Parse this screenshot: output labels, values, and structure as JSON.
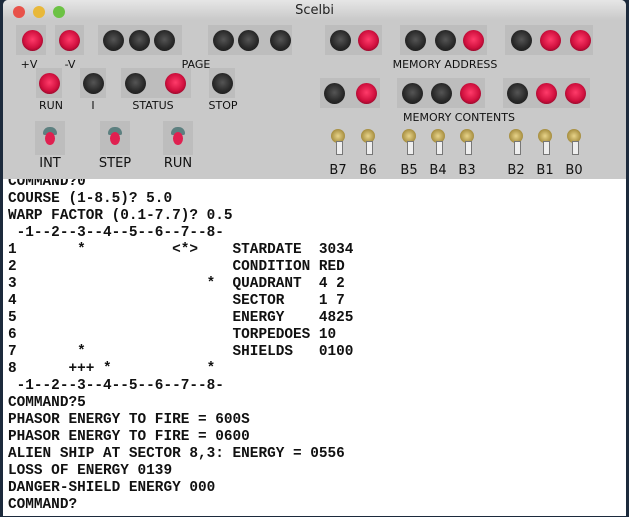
{
  "window": {
    "title": "Scelbi"
  },
  "panel": {
    "power_labels": [
      "+V",
      "-V"
    ],
    "page_label": "PAGE",
    "memory_address_label": "MEMORY ADDRESS",
    "memory_contents_label": "MEMORY CONTENTS",
    "status_labels": [
      "RUN",
      "I",
      "STATUS",
      "STOP"
    ],
    "switch_labels": [
      "INT",
      "STEP",
      "RUN"
    ],
    "bit_labels": [
      "B7",
      "B6",
      "B5",
      "B4",
      "B3",
      "B2",
      "B1",
      "B0"
    ],
    "power_leds": [
      true,
      true
    ],
    "page_leds": [
      false,
      false,
      false,
      false,
      false,
      false
    ],
    "memory_address_leds": [
      false,
      true,
      false,
      false,
      true,
      false,
      true,
      true
    ],
    "status_leds": [
      true,
      false,
      false,
      true,
      false
    ],
    "memory_contents_leds": [
      false,
      true,
      false,
      false,
      true,
      false,
      true,
      true
    ]
  },
  "terminal": {
    "lines": [
      "COMMAND?0",
      "COURSE (1-8.5)? 5.0",
      "WARP FACTOR (0.1-7.7)? 0.5",
      " -1--2--3--4--5--6--7--8-",
      "1       *          <*>    STARDATE  3034",
      "2                         CONDITION RED",
      "3                      *  QUADRANT  4 2",
      "4                         SECTOR    1 7",
      "5                         ENERGY    4825",
      "6                         TORPEDOES 10",
      "7       *                 SHIELDS   0100",
      "8      +++ *           *",
      " -1--2--3--4--5--6--7--8-",
      "COMMAND?5",
      "PHASOR ENERGY TO FIRE = 600S",
      "PHASOR ENERGY TO FIRE = 0600",
      "ALIEN SHIP AT SECTOR 8,3: ENERGY = 0556",
      "LOSS OF ENERGY 0139",
      "DANGER-SHIELD ENERGY 000",
      "COMMAND?"
    ]
  }
}
